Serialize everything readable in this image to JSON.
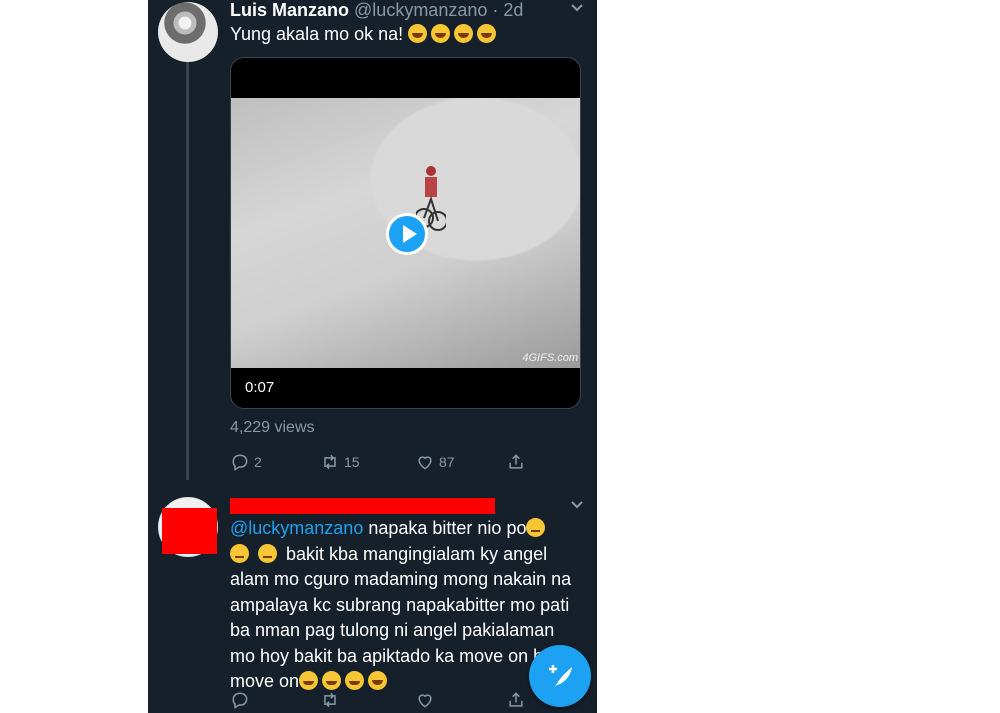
{
  "tweet": {
    "display_name": "Luis Manzano",
    "handle": "@luckymanzano",
    "separator": "·",
    "time": "2d",
    "text": "Yung akala mo ok na!",
    "text_emojis": [
      "laugh-cry-emoji",
      "laugh-cry-emoji",
      "laugh-cry-emoji",
      "laugh-cry-emoji"
    ],
    "media": {
      "duration": "0:07",
      "watermark": "4GIFS.com"
    },
    "views": "4,229 views",
    "actions": {
      "reply_count": "2",
      "retweet_count": "15",
      "like_count": "87"
    }
  },
  "reply": {
    "mention": "@luckymanzano",
    "text_part1": " napaka bitter nio po",
    "text_part2": " bakit kba mangingialam ky angel alam mo cguro madaming mong nakain na ampalaya kc subrang napakabitter mo pati ba nman pag tulong ni angel pakialaman mo hoy bakit ba apiktado ka move on bes move on",
    "actions": {
      "reply_count": "",
      "retweet_count": "",
      "like_count": ""
    }
  },
  "colors": {
    "background": "#15202b",
    "accent": "#1da1f2",
    "muted": "#8899a6",
    "redaction": "#ff0000"
  },
  "icons": [
    "chevron-down-icon",
    "reply-icon",
    "retweet-icon",
    "like-icon",
    "share-icon",
    "play-icon",
    "compose-tweet-icon"
  ]
}
